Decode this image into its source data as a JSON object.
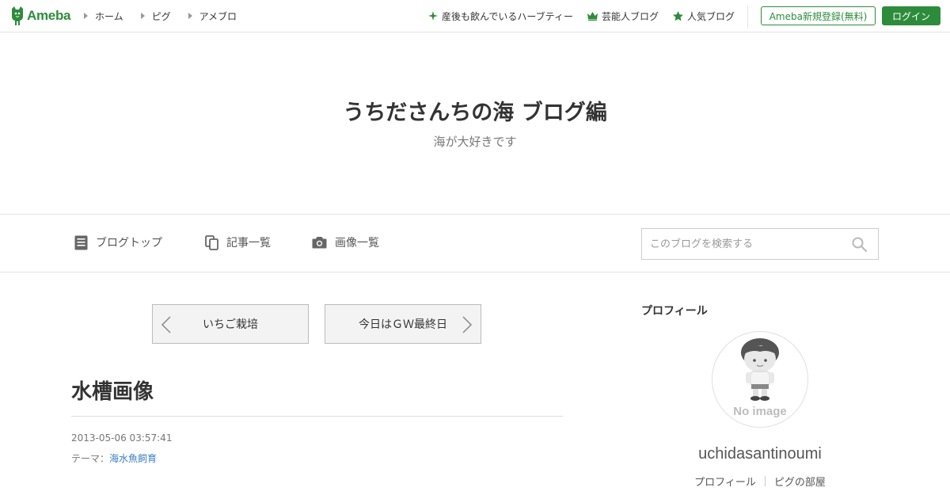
{
  "header": {
    "logo_text": "Ameba",
    "nav": [
      {
        "label": "ホーム"
      },
      {
        "label": "ピグ"
      },
      {
        "label": "アメブロ"
      }
    ],
    "right_nav": [
      {
        "label": "産後も飲んでいるハーブティー",
        "icon": "sparkle-icon"
      },
      {
        "label": "芸能人ブログ",
        "icon": "crown-icon"
      },
      {
        "label": "人気ブログ",
        "icon": "star-icon"
      }
    ],
    "register_label": "Ameba新規登録(無料)",
    "login_label": "ログイン",
    "accent_color": "#2d8c3c"
  },
  "blog": {
    "title": "うちださんちの海 ブログ編",
    "description": "海が大好きです"
  },
  "blog_nav": {
    "items": [
      {
        "label": "ブログトップ",
        "icon": "document-icon"
      },
      {
        "label": "記事一覧",
        "icon": "copy-icon"
      },
      {
        "label": "画像一覧",
        "icon": "camera-icon"
      }
    ],
    "search_placeholder": "このブログを検索する"
  },
  "pager": {
    "prev_label": "いちご栽培",
    "next_label": "今日はＧＷ最終日"
  },
  "entry": {
    "title": "水槽画像",
    "date": "2013-05-06 03:57:41",
    "theme_prefix": "テーマ：",
    "theme": "海水魚飼育",
    "link_color": "#3a7ec0"
  },
  "sidebar": {
    "heading": "プロフィール",
    "avatar_text": "No image",
    "username": "uchidasantinoumi",
    "links": [
      {
        "label": "プロフィール"
      },
      {
        "label": "ピグの部屋"
      }
    ]
  }
}
